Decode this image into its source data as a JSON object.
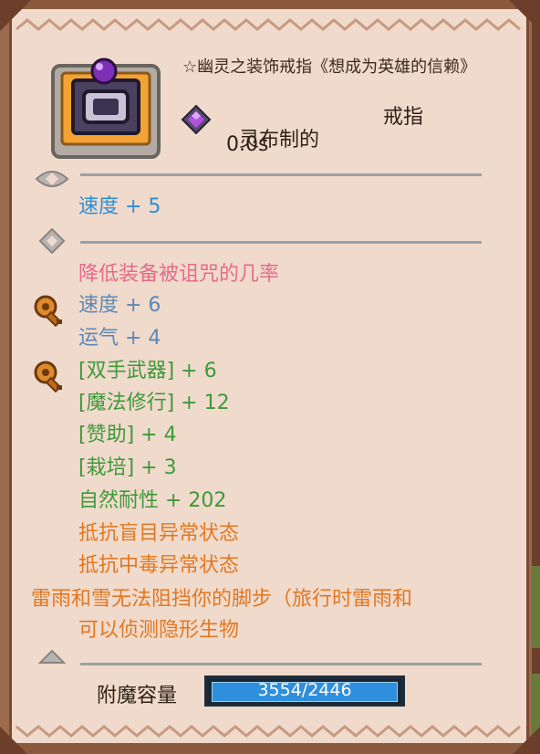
{
  "item": {
    "title": "☆幽灵之装饰戒指《想成为英雄的信赖》",
    "material": "灵布制的",
    "type": "戒指",
    "time": "0.0s",
    "item_icon": "purple-gem-ring-icon",
    "rarity_icon": "purple-diamond-gem-icon"
  },
  "sections": {
    "base_stats": [
      "速度 + 5"
    ],
    "enchant_header": "降低装备被诅咒的几率",
    "group1": [
      "速度 + 6",
      "运气 + 4"
    ],
    "group2": [
      "[双手武器] + 6",
      "[魔法修行] + 12",
      "[赞助] + 4",
      "[栽培] + 3",
      "自然耐性 + 202"
    ],
    "resist": [
      "抵抗盲目异常状态",
      "抵抗中毒异常状态"
    ],
    "special": [
      "雷雨和雪无法阻挡你的脚步（旅行时雷雨和",
      "可以侦测隐形生物"
    ]
  },
  "enchant_capacity": {
    "label": "附魔容量",
    "value_text": "3554/2446",
    "current": 3554,
    "max": 2446,
    "fill_fraction": 1.0
  },
  "colors": {
    "frame": "#f0dacb",
    "border": "#7a4a33",
    "accent_blue": "#2d8ed8",
    "pink": "#e56b8c",
    "green": "#3d9a3a",
    "orange": "#e07823"
  }
}
